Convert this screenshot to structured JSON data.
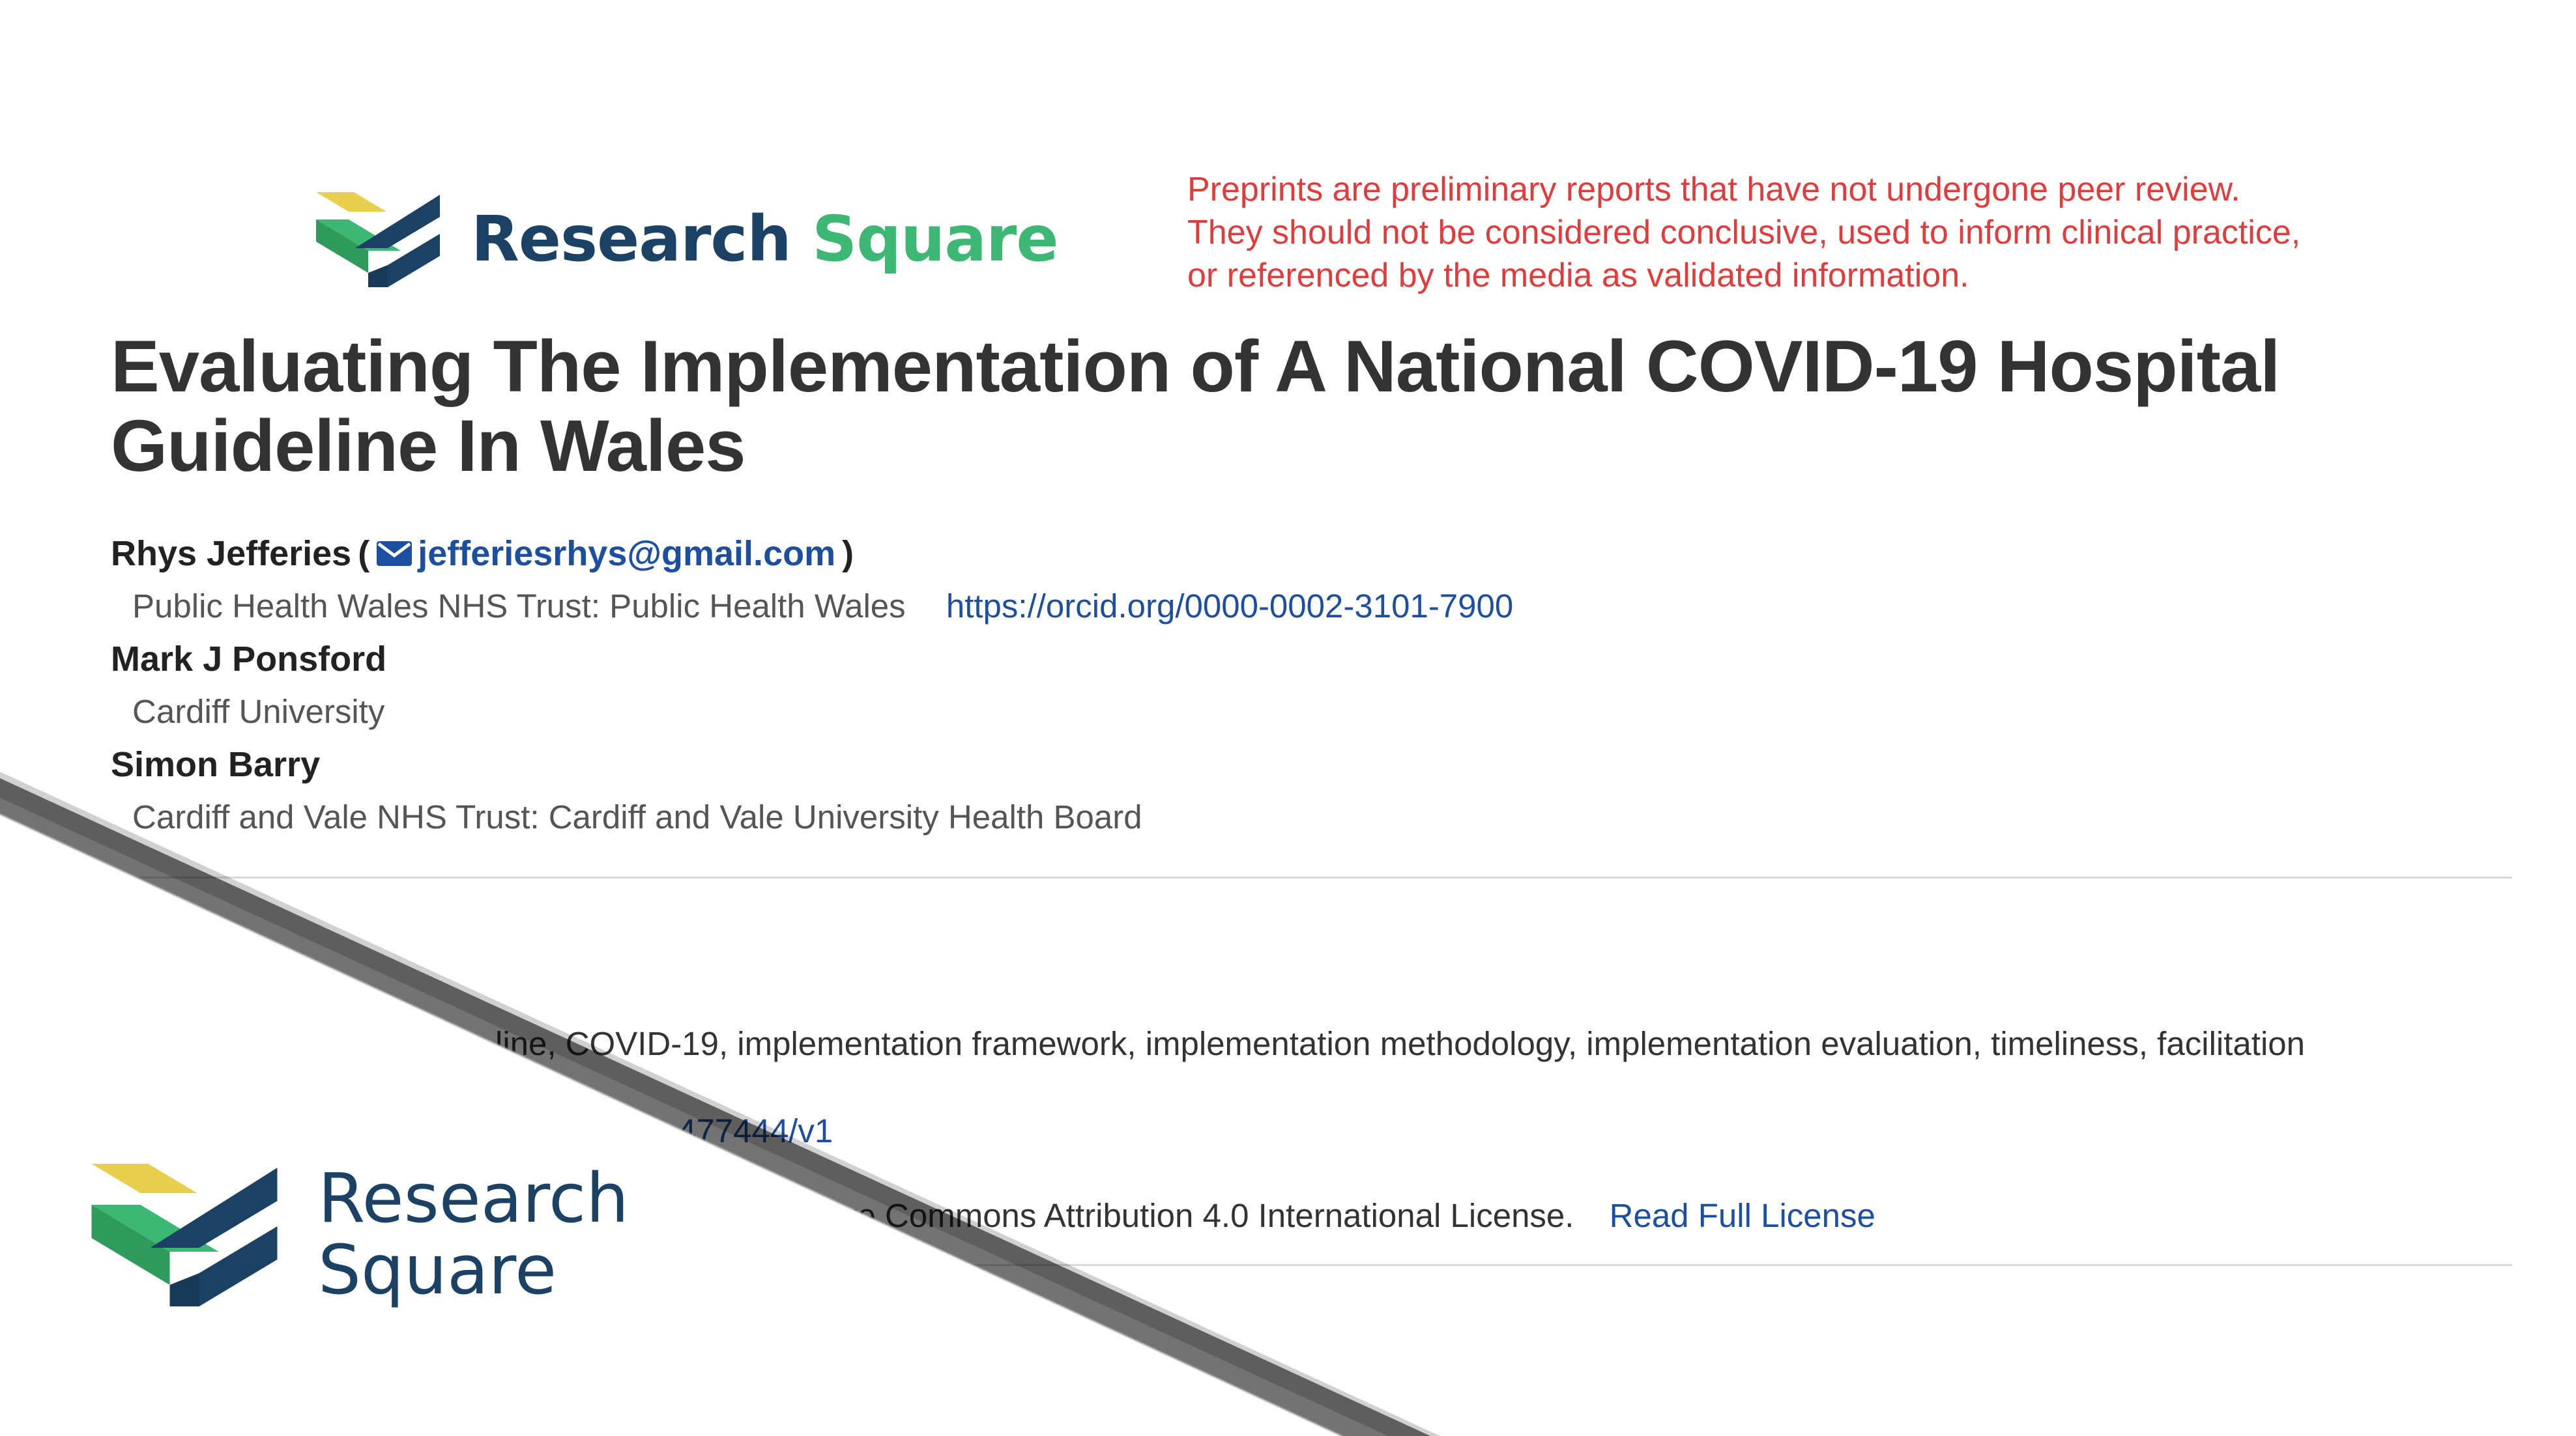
{
  "header": {
    "logo_word_1": "Research",
    "logo_word_2": "Square",
    "disclaimer_lines": [
      "Preprints are preliminary reports that have not undergone peer review.",
      "They should not be considered conclusive, used to inform clinical practice,",
      "or referenced by the media as validated information."
    ]
  },
  "paper": {
    "title": "Evaluating The Implementation of A National COVID-19 Hospital Guideline In Wales",
    "authors": [
      {
        "name": "Rhys Jefferies",
        "email": "jefferiesrhys@gmail.com",
        "affiliation": "Public Health Wales NHS Trust: Public Health Wales",
        "orcid": "https://orcid.org/0000-0002-3101-7900"
      },
      {
        "name": "Mark J Ponsford",
        "affiliation": "Cardiff University"
      },
      {
        "name": "Simon Barry",
        "affiliation": "Cardiff and Vale NHS Trust: Cardiff and Vale University Health Board"
      }
    ],
    "keywords_visible": "line, COVID-19, implementation framework, implementation methodology, implementation evaluation, timeliness, facilitation",
    "doi_visible": "477444/v1",
    "license_visible": "ve Commons Attribution 4.0 International License.",
    "license_link": "Read Full License"
  },
  "corner_logo": {
    "line_1": "Research",
    "line_2": "Square"
  },
  "colors": {
    "brand_navy": "#1b4265",
    "brand_green": "#3db774",
    "brand_yellow": "#e8d04e",
    "disclaimer_red": "#e23b3b",
    "link_blue": "#1d4fa0"
  }
}
